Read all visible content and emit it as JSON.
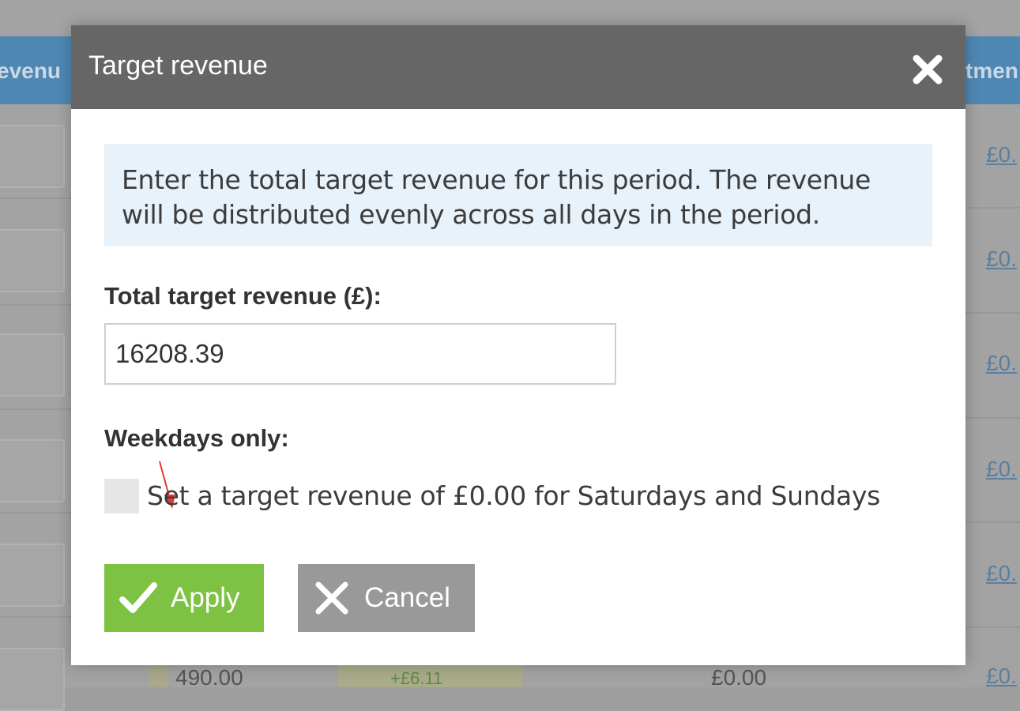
{
  "background": {
    "header_left_text": "evenu",
    "header_right_text": "tmen",
    "right_column_links": [
      "£0.",
      "£0.",
      "£0.",
      "£0.",
      "£0.",
      "£0."
    ],
    "bottom_row": [
      "490.00",
      "+£6.11",
      "£0.00"
    ]
  },
  "dialog": {
    "title": "Target revenue",
    "close_icon": "close-icon",
    "info_text": "Enter the total target revenue for this period. The revenue will be distributed evenly across all days in the period.",
    "total_label": "Total target revenue (£):",
    "total_value": "16208.39",
    "weekdays_label": "Weekdays only:",
    "weekdays_checkbox_label": "Set a target revenue of £0.00 for Saturdays and Sundays",
    "weekdays_checked": false,
    "apply_label": "Apply",
    "cancel_label": "Cancel"
  },
  "colors": {
    "header_bg": "#666666",
    "info_bg": "#e8f2fa",
    "apply_bg": "#7dc242",
    "cancel_bg": "#999999",
    "annotation_arrow": "#e53935"
  }
}
